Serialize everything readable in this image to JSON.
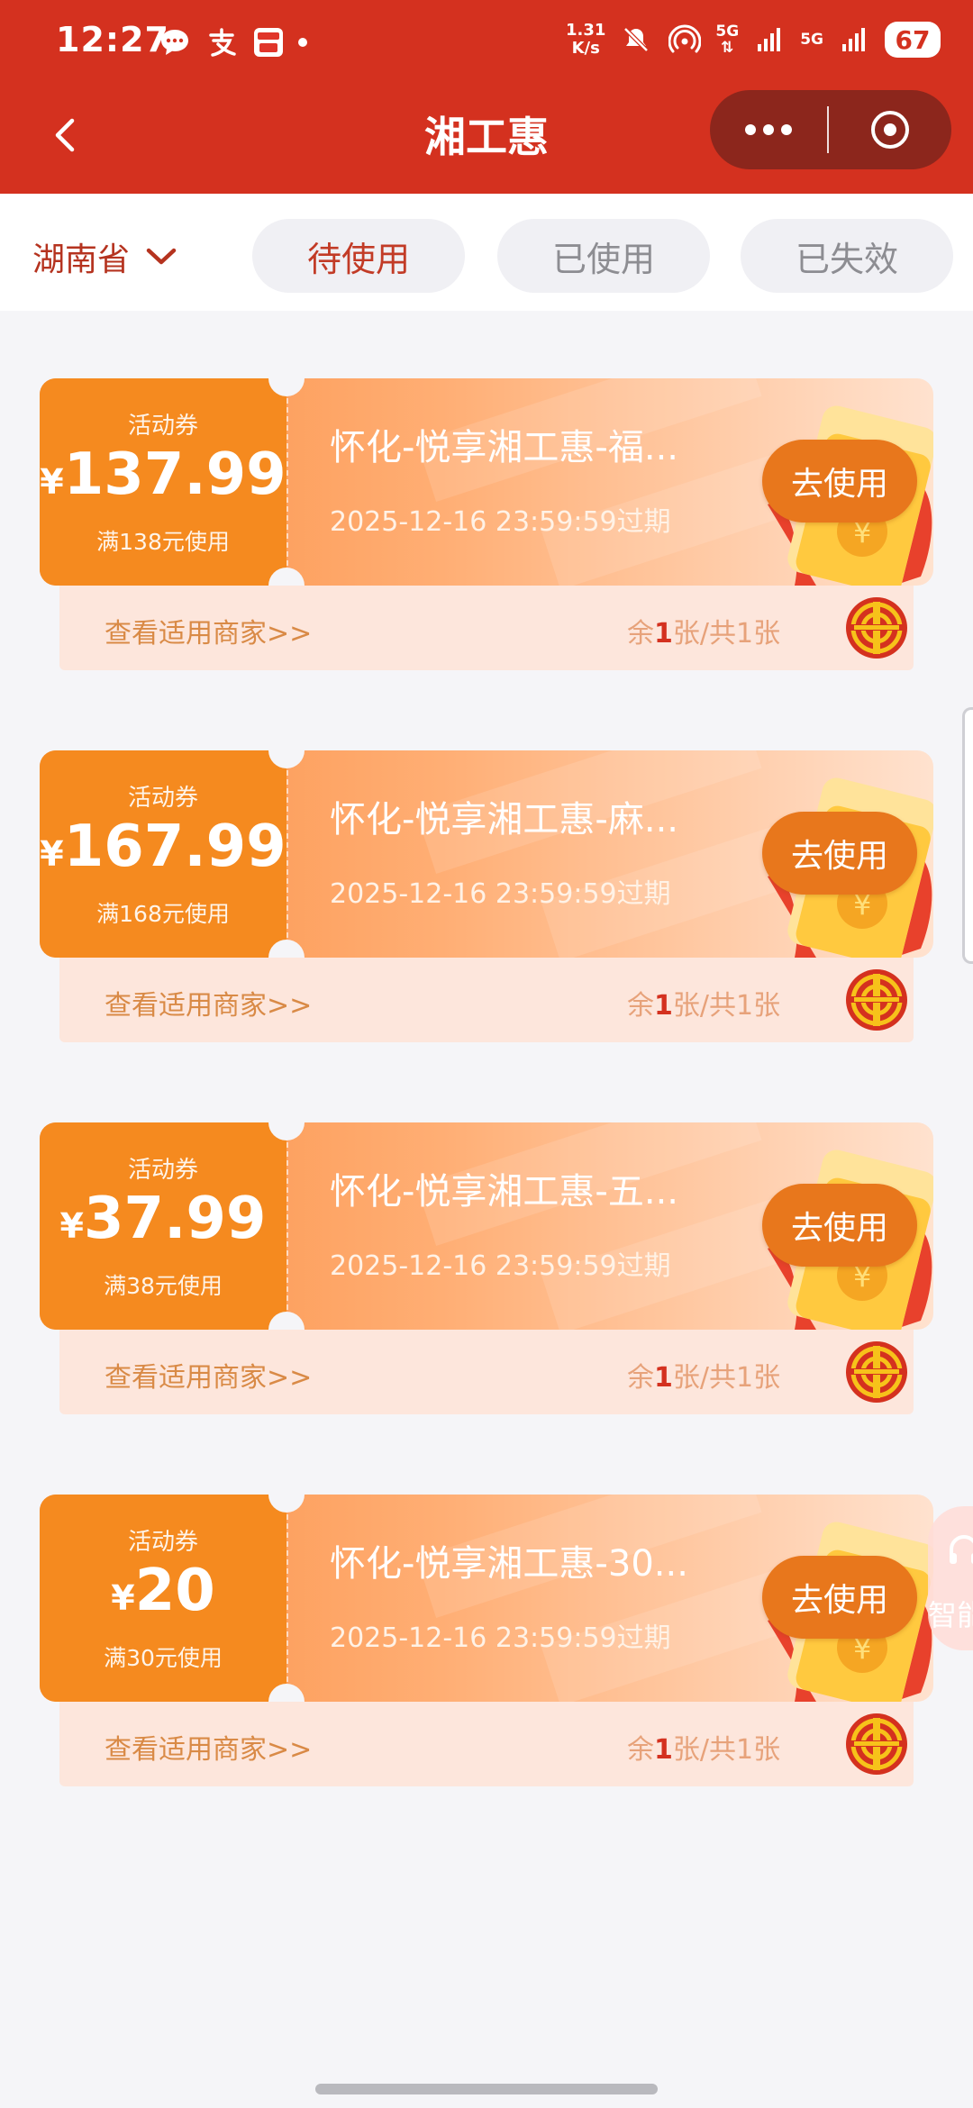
{
  "status_bar": {
    "time": "12:27",
    "network_speed_value": "1.31",
    "network_speed_unit": "K/s",
    "signal_1": "5G",
    "signal_2": "5G",
    "battery": "67",
    "icons": [
      "chat-bubble-icon",
      "alipay-icon",
      "app-notification-icon",
      "mute-icon",
      "hotspot-icon",
      "signal-icon",
      "battery-icon"
    ]
  },
  "nav": {
    "title": "湘工惠",
    "back_icon": "chevron-left-icon",
    "more_icon": "more-dots-icon",
    "close_icon": "close-circle-icon"
  },
  "filter": {
    "province": "湖南省",
    "tabs": [
      {
        "label": "待使用",
        "active": true
      },
      {
        "label": "已使用",
        "active": false
      },
      {
        "label": "已失效",
        "active": false
      }
    ]
  },
  "coupons": [
    {
      "label": "活动券",
      "currency": "¥",
      "amount": "137.99",
      "condition": "满138元使用",
      "title": "怀化-悦享湘工惠-福...",
      "expiry": "2025-12-16 23:59:59过期",
      "use_label": "去使用",
      "merchants_link": "查看适用商家>>",
      "remaining_prefix": "余",
      "remaining_count": "1",
      "remaining_suffix": "张/共1张"
    },
    {
      "label": "活动券",
      "currency": "¥",
      "amount": "167.99",
      "condition": "满168元使用",
      "title": "怀化-悦享湘工惠-麻...",
      "expiry": "2025-12-16 23:59:59过期",
      "use_label": "去使用",
      "merchants_link": "查看适用商家>>",
      "remaining_prefix": "余",
      "remaining_count": "1",
      "remaining_suffix": "张/共1张"
    },
    {
      "label": "活动券",
      "currency": "¥",
      "amount": "37.99",
      "condition": "满38元使用",
      "title": "怀化-悦享湘工惠-五...",
      "expiry": "2025-12-16 23:59:59过期",
      "use_label": "去使用",
      "merchants_link": "查看适用商家>>",
      "remaining_prefix": "余",
      "remaining_count": "1",
      "remaining_suffix": "张/共1张"
    },
    {
      "label": "活动券",
      "currency": "¥",
      "amount": "20",
      "condition": "满30元使用",
      "title": "怀化-悦享湘工惠-30...",
      "expiry": "2025-12-16 23:59:59过期",
      "use_label": "去使用",
      "merchants_link": "查看适用商家>>",
      "remaining_prefix": "余",
      "remaining_count": "1",
      "remaining_suffix": "张/共1张"
    }
  ],
  "assistant": {
    "label": "智能",
    "icon": "headset-icon"
  },
  "colors": {
    "brand_red": "#d4311f",
    "coupon_orange": "#f58a1f",
    "button_orange": "#e8771c",
    "tab_active_text": "#c23b26",
    "tab_inactive_text": "#8d8d92"
  }
}
